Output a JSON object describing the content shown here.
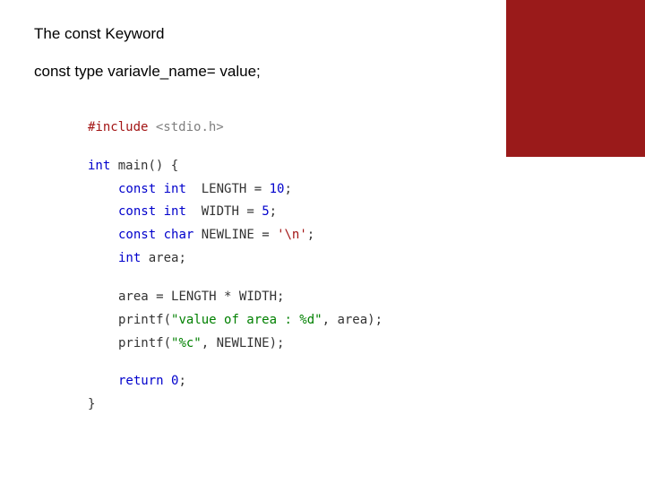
{
  "heading": "The const Keyword",
  "syntax": "const type variavle_name= value;",
  "code": {
    "preproc_directive": "#include",
    "preproc_header": "<stdio.h>",
    "int_kw": "int",
    "main_fn": "main",
    "lparen": "(",
    "rparen": ")",
    "space": " ",
    "lbrace": "{",
    "rbrace": "}",
    "const_kw": "const",
    "char_kw": "char",
    "length_ident": "LENGTH",
    "width_ident": "WIDTH",
    "newline_ident": "NEWLINE",
    "area_ident": "area",
    "eq": " = ",
    "ten": "10",
    "five": "5",
    "nl_char": "'\\n'",
    "semi": ";",
    "star": " * ",
    "printf1_fn": "printf",
    "printf1_str": "\"value of area : %d\"",
    "comma": ", ",
    "printf2_str": "\"%c\"",
    "return_kw": "return",
    "zero": "0"
  }
}
